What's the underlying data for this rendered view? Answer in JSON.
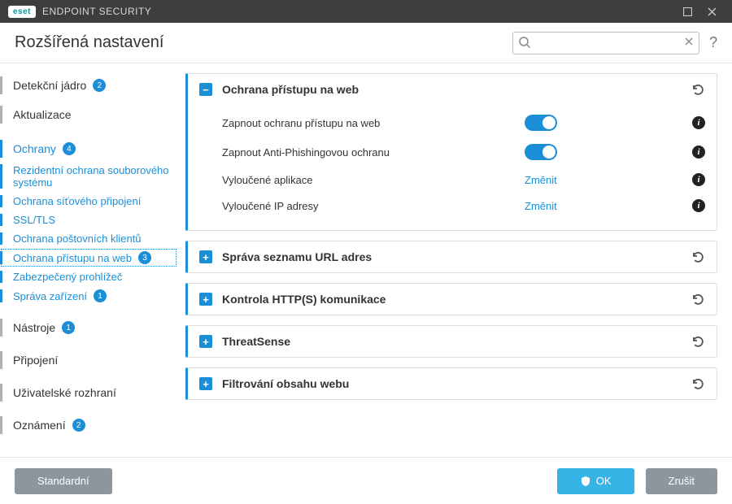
{
  "titlebar": {
    "brand_badge": "eset",
    "brand_text": "ENDPOINT SECURITY"
  },
  "page_title": "Rozšířená nastavení",
  "search": {
    "placeholder": ""
  },
  "help_label": "?",
  "sidebar": {
    "items": [
      {
        "label": "Detekční jádro",
        "badge": "2",
        "type": "top",
        "accent": false
      },
      {
        "label": "Aktualizace",
        "type": "top",
        "accent": false
      },
      {
        "label": "Ochrany",
        "badge": "4",
        "type": "top",
        "accent": true
      },
      {
        "label": "Rezidentní ochrana souborového systému",
        "type": "sub"
      },
      {
        "label": "Ochrana síťového připojení",
        "type": "sub"
      },
      {
        "label": "SSL/TLS",
        "type": "sub"
      },
      {
        "label": "Ochrana poštovních klientů",
        "type": "sub"
      },
      {
        "label": "Ochrana přístupu na web",
        "badge": "3",
        "type": "sub",
        "selected": true
      },
      {
        "label": "Zabezpečený prohlížeč",
        "type": "sub"
      },
      {
        "label": "Správa zařízení",
        "badge": "1",
        "type": "sub"
      },
      {
        "label": "Nástroje",
        "badge": "1",
        "type": "top",
        "accent": false
      },
      {
        "label": "Připojení",
        "type": "top",
        "accent": false
      },
      {
        "label": "Uživatelské rozhraní",
        "type": "top",
        "accent": false
      },
      {
        "label": "Oznámení",
        "badge": "2",
        "type": "top",
        "accent": false
      }
    ]
  },
  "panels": {
    "p0": {
      "title": "Ochrana přístupu na web",
      "rows": [
        {
          "label": "Zapnout ochranu přístupu na web",
          "control": "toggle"
        },
        {
          "label": "Zapnout Anti-Phishingovou ochranu",
          "control": "toggle"
        },
        {
          "label": "Vyloučené aplikace",
          "control": "link",
          "link_text": "Změnit"
        },
        {
          "label": "Vyloučené IP adresy",
          "control": "link",
          "link_text": "Změnit"
        }
      ]
    },
    "p1": {
      "title": "Správa seznamu URL adres"
    },
    "p2": {
      "title": "Kontrola HTTP(S) komunikace"
    },
    "p3": {
      "title": "ThreatSense"
    },
    "p4": {
      "title": "Filtrování obsahu webu"
    }
  },
  "footer": {
    "default_btn": "Standardní",
    "ok_btn": "OK",
    "cancel_btn": "Zrušit"
  }
}
